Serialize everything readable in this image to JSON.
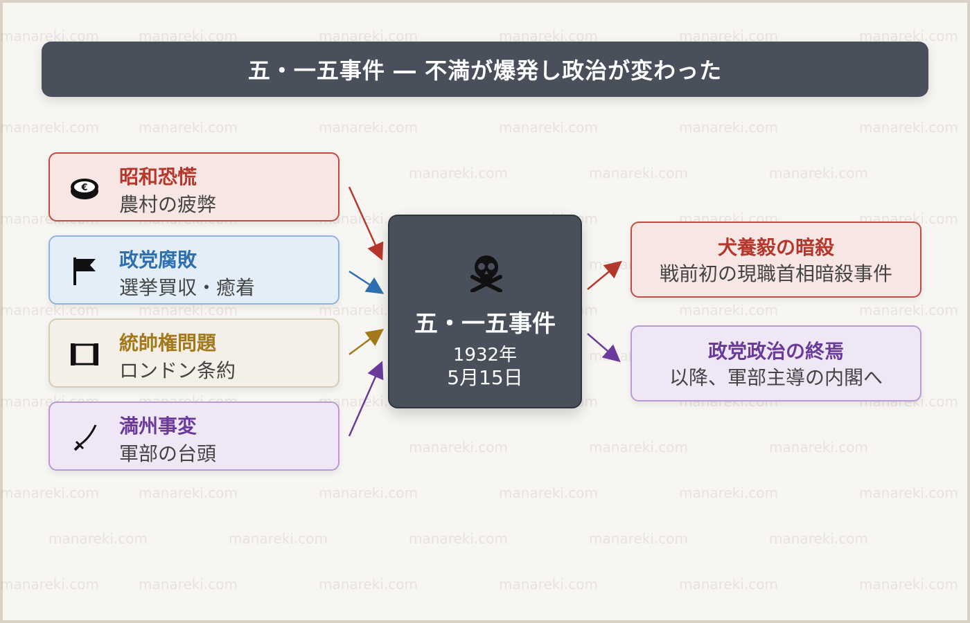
{
  "watermark": "manareki.com",
  "title": "五・一五事件 ― 不満が爆発し政治が変わった",
  "causes": [
    {
      "title": "昭和恐慌",
      "subtitle": "農村の疲弊",
      "icon": "coin-icon",
      "color": "#b5372b",
      "bg": "#f7e6e3",
      "border": "#bf4c40"
    },
    {
      "title": "政党腐敗",
      "subtitle": "選挙買収・癒着",
      "icon": "flag-icon",
      "color": "#2e6fb0",
      "bg": "#e4eef9",
      "border": "#8fb3df"
    },
    {
      "title": "統帥権問題",
      "subtitle": "ロンドン条約",
      "icon": "scroll-icon",
      "color": "#a3781b",
      "bg": "#f4f0e8",
      "border": "#d6cbb5"
    },
    {
      "title": "満州事変",
      "subtitle": "軍部の台頭",
      "icon": "sword-icon",
      "color": "#6a3a9a",
      "bg": "#efe7f6",
      "border": "#b99ad6"
    }
  ],
  "center": {
    "icon": "skull-crossbones-icon",
    "title": "五・一五事件",
    "year": "1932年",
    "date": "5月15日"
  },
  "results": [
    {
      "title": "犬養毅の暗殺",
      "subtitle": "戦前初の現職首相暗殺事件",
      "color": "#b5372b",
      "bg": "#f7e6e3",
      "border": "#bf4c40"
    },
    {
      "title": "政党政治の終焉",
      "subtitle": "以降、軍部主導の内閣へ",
      "color": "#6a3a9a",
      "bg": "#efe7f6",
      "border": "#b99ad6"
    }
  ]
}
